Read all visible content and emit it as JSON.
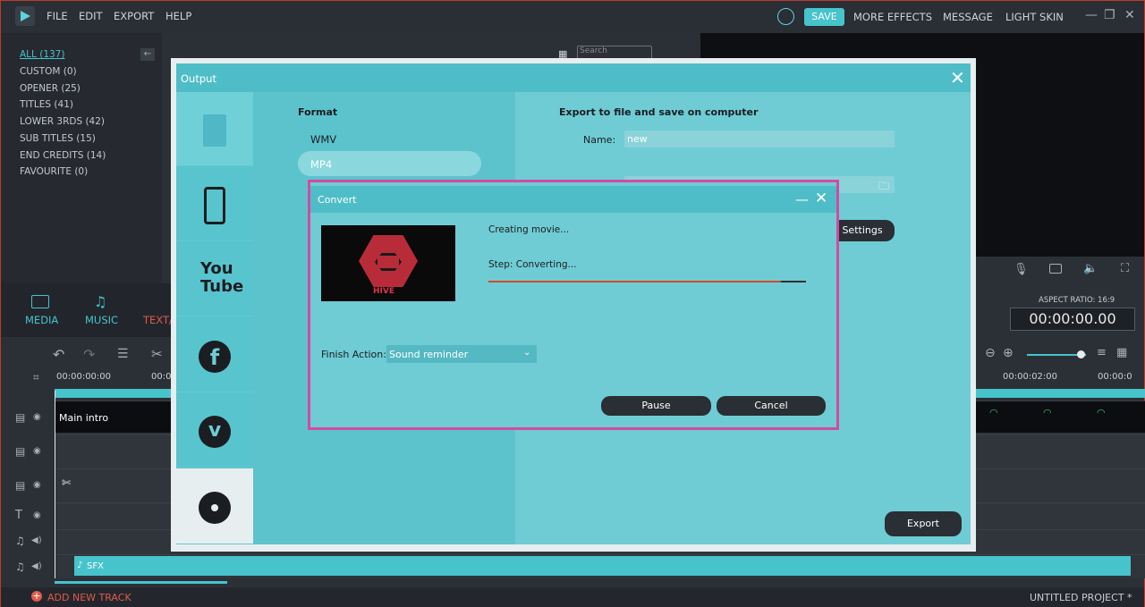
{
  "menu": {
    "file": "FILE",
    "edit": "EDIT",
    "export": "EXPORT",
    "help": "HELP"
  },
  "topright": {
    "save": "SAVE",
    "more_effects": "MORE EFFECTS",
    "message": "MESSAGE",
    "light_skin": "LIGHT SKIN"
  },
  "library": {
    "items": [
      "ALL (137)",
      "CUSTOM (0)",
      "OPENER (25)",
      "TITLES (41)",
      "LOWER 3RDS (42)",
      "SUB TITLES (15)",
      "END CREDITS (14)",
      "FAVOURITE (0)"
    ],
    "search_placeholder": "Search"
  },
  "tabs": {
    "media": "MEDIA",
    "music": "MUSIC",
    "text": "TEXT/"
  },
  "timeline": {
    "time_start": "00:00:00:00",
    "time_2": "00:0",
    "time_end": "00:00:02:00",
    "time_end2": "00:00:0",
    "main_clip": "Main intro",
    "sfx": "SFX",
    "add_track": "ADD NEW TRACK",
    "project": "UNTITLED PROJECT *"
  },
  "preview": {
    "aspect": "ASPECT RATIO: 16:9",
    "timecode": "00:00:00.00"
  },
  "output": {
    "title": "Output",
    "format_heading": "Format",
    "formats": [
      "WMV",
      "MP4"
    ],
    "export_heading": "Export to file and save on computer",
    "name_label": "Name:",
    "name_value": "new",
    "settings_label": "Settings",
    "export_button": "Export"
  },
  "convert": {
    "title": "Convert",
    "status": "Creating movie...",
    "step": "Step: Converting...",
    "progress": 0.92,
    "finish_label": "Finish Action:",
    "finish_value": "Sound reminder",
    "pause": "Pause",
    "cancel": "Cancel",
    "thumb_text": "HIVE"
  },
  "colors": {
    "accent": "#47c3cc",
    "dialog_border": "#d34aa3",
    "progress": "#d24a2c"
  }
}
